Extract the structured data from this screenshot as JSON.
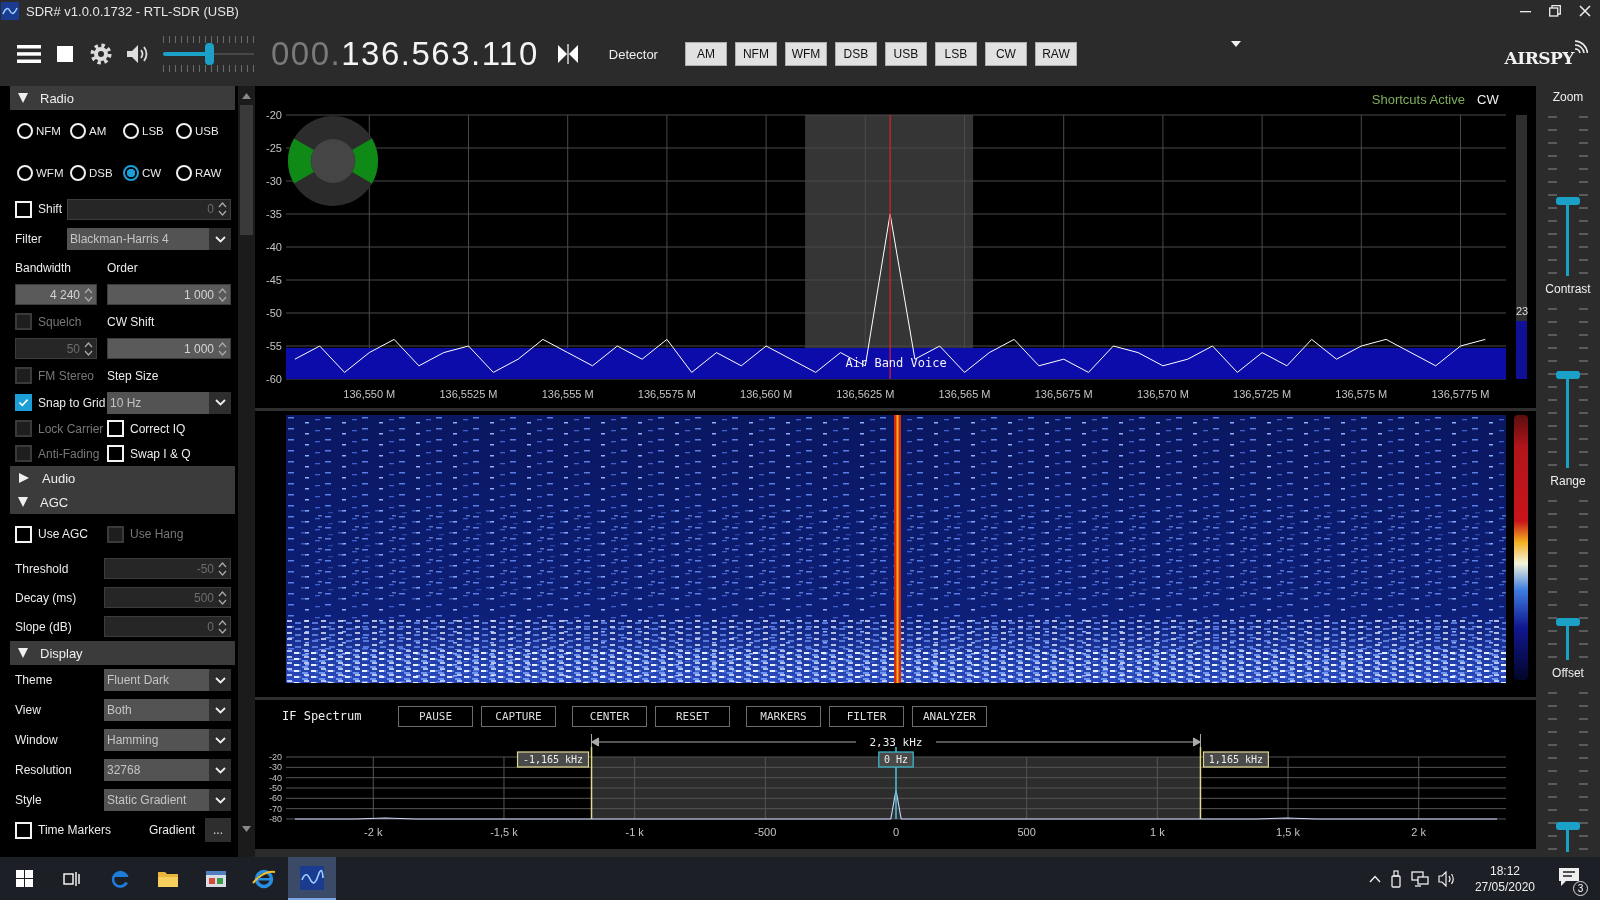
{
  "window": {
    "title": "SDR# v1.0.0.1732 - RTL-SDR (USB)"
  },
  "toolbar": {
    "volume": {
      "level": 0.5
    },
    "frequency": {
      "prefix": "000.",
      "value": "136.563.110"
    },
    "detector_label": "Detector",
    "detectors": [
      "AM",
      "NFM",
      "WFM",
      "DSB",
      "USB",
      "LSB",
      "CW",
      "RAW"
    ],
    "logo": "AIRSPY"
  },
  "sidebar": {
    "sections": [
      {
        "title": "Radio",
        "expanded": true,
        "rows": [
          {
            "kind": "radios",
            "options": [
              {
                "label": "NFM",
                "selected": false
              },
              {
                "label": "AM",
                "selected": false
              },
              {
                "label": "LSB",
                "selected": false
              },
              {
                "label": "USB",
                "selected": false
              }
            ]
          },
          {
            "kind": "radios",
            "options": [
              {
                "label": "WFM",
                "selected": false
              },
              {
                "label": "DSB",
                "selected": false
              },
              {
                "label": "CW",
                "selected": true
              },
              {
                "label": "RAW",
                "selected": false
              }
            ]
          },
          {
            "kind": "check-field",
            "check": {
              "label": "Shift",
              "checked": false,
              "disabled": false
            },
            "field": {
              "value": "0",
              "disabled": true
            }
          },
          {
            "kind": "wide-dropdown",
            "label": "Filter",
            "value": "Blackman-Harris 4"
          },
          {
            "kind": "labels",
            "labels": [
              "Bandwidth",
              "Order"
            ]
          },
          {
            "kind": "fields",
            "fields": [
              {
                "value": "4 240",
                "disabled": false
              },
              {
                "value": "1 000",
                "disabled": false
              }
            ]
          },
          {
            "kind": "check-label",
            "check": {
              "label": "Squelch",
              "checked": false,
              "disabled": true
            },
            "label": "CW Shift"
          },
          {
            "kind": "fields",
            "fields": [
              {
                "value": "50",
                "disabled": true
              },
              {
                "value": "1 000",
                "disabled": false
              }
            ]
          },
          {
            "kind": "check-label",
            "check": {
              "label": "FM Stereo",
              "checked": false,
              "disabled": true
            },
            "label": "Step Size"
          },
          {
            "kind": "check-dropdown",
            "check": {
              "label": "Snap to Grid",
              "checked": true,
              "disabled": false
            },
            "value": "10 Hz"
          },
          {
            "kind": "checks",
            "checks": [
              {
                "label": "Lock Carrier",
                "checked": false,
                "disabled": true
              },
              {
                "label": "Correct IQ",
                "checked": false,
                "disabled": false
              }
            ]
          },
          {
            "kind": "checks",
            "checks": [
              {
                "label": "Anti-Fading",
                "checked": false,
                "disabled": true
              },
              {
                "label": "Swap I & Q",
                "checked": false,
                "disabled": false
              }
            ]
          }
        ]
      },
      {
        "title": "Audio",
        "expanded": false
      },
      {
        "title": "AGC",
        "expanded": true,
        "rows": [
          {
            "kind": "checks",
            "checks": [
              {
                "label": "Use AGC",
                "checked": false,
                "disabled": false
              },
              {
                "label": "Use Hang",
                "checked": false,
                "disabled": true
              }
            ]
          },
          {
            "kind": "field",
            "label": "Threshold",
            "field": {
              "value": "-50",
              "disabled": true
            }
          },
          {
            "kind": "field",
            "label": "Decay (ms)",
            "field": {
              "value": "500",
              "disabled": true
            }
          },
          {
            "kind": "field",
            "label": "Slope (dB)",
            "field": {
              "value": "0",
              "disabled": true
            }
          }
        ]
      },
      {
        "title": "Display",
        "expanded": true,
        "rows": [
          {
            "kind": "dropdown",
            "label": "Theme",
            "value": "Fluent Dark"
          },
          {
            "kind": "dropdown",
            "label": "View",
            "value": "Both"
          },
          {
            "kind": "dropdown",
            "label": "Window",
            "value": "Hamming"
          },
          {
            "kind": "dropdown",
            "label": "Resolution",
            "value": "32768"
          },
          {
            "kind": "dropdown",
            "label": "Style",
            "value": "Static Gradient"
          },
          {
            "kind": "check-button",
            "check": {
              "label": "Time Markers",
              "checked": false,
              "disabled": false
            },
            "label": "Gradient",
            "button": "..."
          }
        ]
      }
    ]
  },
  "spectrum": {
    "status": "Shortcuts Active",
    "mode": "CW",
    "meter": {
      "reading": "23",
      "level": 0.22
    },
    "chart_data": {
      "type": "line",
      "grid": true,
      "ylim": [
        -60,
        -20
      ],
      "bands": [
        {
          "axis": "y",
          "from": -60,
          "to": -55.3,
          "color": "#0c0cab",
          "label": "Air Band Voice"
        }
      ],
      "yticks": [
        -20,
        -25,
        -30,
        -35,
        -40,
        -45,
        -50,
        -55,
        -60
      ],
      "categories": [
        null,
        null,
        null,
        "136,550 M",
        null,
        null,
        null,
        "136,5525 M",
        null,
        null,
        null,
        "136,555 M",
        null,
        null,
        null,
        "136,5575 M",
        null,
        null,
        null,
        "136,560 M",
        null,
        null,
        null,
        "136,5625 M",
        null,
        null,
        null,
        "136,565 M",
        null,
        null,
        null,
        "136,5675 M",
        null,
        null,
        null,
        "136,570 M",
        null,
        null,
        null,
        "136,5725 M",
        null,
        null,
        null,
        "136,575 M",
        null,
        null,
        null,
        "136,5775 M",
        null
      ],
      "series": [
        {
          "color": "#ffffff",
          "values": [
            -57,
            -55,
            -59,
            -56,
            -54,
            -58,
            -56,
            -55,
            -59,
            -57,
            -54,
            -56,
            -58,
            -55,
            -57,
            -54,
            -59,
            -56,
            -58,
            -55,
            -57,
            -59,
            -56,
            -58,
            -35,
            -57,
            -55,
            -59,
            -56,
            -54,
            -58,
            -57,
            -59,
            -55,
            -56,
            -58,
            -57,
            -55,
            -59,
            -56,
            -58,
            -54,
            -57,
            -55,
            -54,
            -56,
            -58,
            -55,
            -54
          ]
        }
      ]
    }
  },
  "if_spectrum": {
    "title": "IF Spectrum",
    "buttons": [
      "PAUSE",
      "CAPTURE",
      "CENTER",
      "RESET",
      "MARKERS",
      "FILTER",
      "ANALYZER"
    ],
    "span": "2,33 kHz",
    "chart_data": {
      "type": "line",
      "grid": true,
      "xlim": [
        -2334,
        2334
      ],
      "ylim": [
        -80,
        -20
      ],
      "bands": [
        {
          "axis": "x",
          "from": -1165,
          "to": 1165,
          "color": "#2d2d2d"
        }
      ],
      "ref_lines": [
        {
          "axis": "x",
          "value": -1165,
          "label": "-1,165 kHz",
          "color": "#e0d88c"
        },
        {
          "axis": "x",
          "value": 0,
          "label": "0 Hz",
          "color": "#3fbfcf"
        },
        {
          "axis": "x",
          "value": 1165,
          "label": "1,165 kHz",
          "color": "#e0d88c"
        }
      ],
      "xticks": [
        {
          "value": -2000,
          "label": "-2 k"
        },
        {
          "value": -1500,
          "label": "-1,5 k"
        },
        {
          "value": -1000,
          "label": "-1 k"
        },
        -500,
        0,
        500,
        {
          "value": 1000,
          "label": "1 k"
        },
        {
          "value": 1500,
          "label": "1,5 k"
        },
        {
          "value": 2000,
          "label": "2 k"
        }
      ],
      "yticks": [
        -20,
        -30,
        -40,
        -50,
        -60,
        -70,
        -80
      ],
      "x": [
        -2300,
        -2185,
        -2070,
        -1955,
        -1840,
        -1725,
        -1610,
        -1495,
        -1380,
        -1265,
        -1150,
        -1035,
        -920,
        -805,
        -690,
        -575,
        -460,
        -345,
        -230,
        -115,
        -20,
        0,
        20,
        115,
        230,
        345,
        460,
        575,
        690,
        805,
        920,
        1035,
        1150,
        1265,
        1380,
        1495,
        1610,
        1725,
        1840,
        1955,
        2070,
        2185,
        2300
      ],
      "series": [
        {
          "color": "#cfd8ff",
          "values": [
            -80,
            -80,
            -80,
            -79,
            -80,
            -80,
            -80,
            -80,
            -80,
            -80,
            -80,
            -80,
            -80,
            -80,
            -80,
            -80,
            -80,
            -80,
            -80,
            -80,
            -80,
            -52,
            -80,
            -80,
            -80,
            -80,
            -80,
            -80,
            -80,
            -80,
            -80,
            -80,
            -80,
            -80,
            -80,
            -79,
            -80,
            -80,
            -80,
            -80,
            -80,
            -80,
            -80
          ]
        }
      ]
    }
  },
  "display_controls": [
    {
      "label": "Zoom",
      "level": 0.47
    },
    {
      "label": "Contrast",
      "level": 0.58
    },
    {
      "label": "Range",
      "level": 0.24
    },
    {
      "label": "Offset",
      "level": 0.16
    }
  ],
  "taskbar": {
    "apps": [
      {
        "selected": false
      },
      {
        "selected": false
      },
      {
        "selected": false
      },
      {
        "selected": false
      },
      {
        "selected": false
      },
      {
        "selected": false
      },
      {
        "selected": true
      }
    ],
    "time": "18:12",
    "date": "27/05/2020",
    "notifications": "3"
  }
}
